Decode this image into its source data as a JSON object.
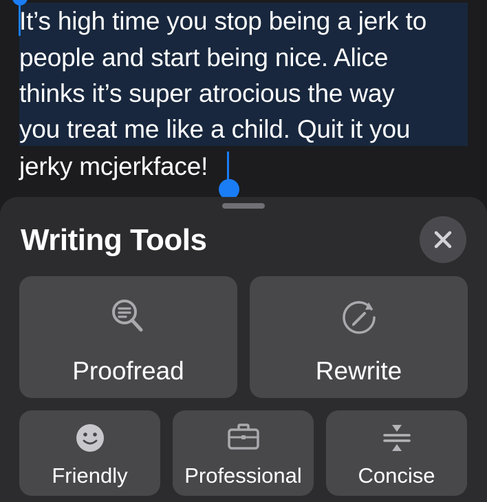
{
  "document": {
    "lines": [
      "It’s high time you stop being a jerk to",
      "people and start being nice. Alice",
      "thinks it’s super atrocious the way",
      "you treat me like a child. Quit it you",
      "jerky mcjerkface!"
    ]
  },
  "writing_tools": {
    "title": "Writing Tools",
    "close_icon": "xmark-icon",
    "primary": [
      {
        "label": "Proofread",
        "icon": "magnifier-text-icon"
      },
      {
        "label": "Rewrite",
        "icon": "rewrite-pen-icon"
      }
    ],
    "tones": [
      {
        "label": "Friendly",
        "icon": "smiley-face-icon"
      },
      {
        "label": "Professional",
        "icon": "briefcase-icon"
      },
      {
        "label": "Concise",
        "icon": "condense-icon"
      }
    ]
  },
  "colors": {
    "selection_highlight": "#18273d",
    "selection_handle": "#1a7df5",
    "sheet_background": "#2c2c2e",
    "button_background": "#48484b",
    "page_background": "#1c1c1e"
  }
}
